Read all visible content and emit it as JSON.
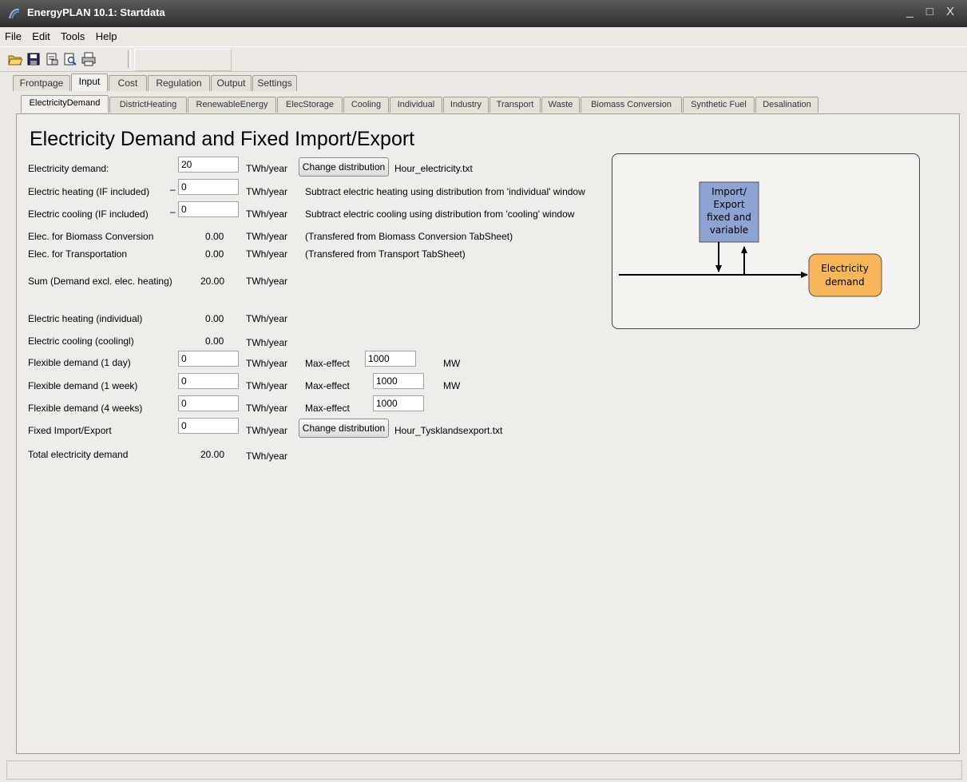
{
  "window": {
    "title": "EnergyPLAN 10.1: Startdata",
    "controls": "_ □ X"
  },
  "menu": [
    "File",
    "Edit",
    "Tools",
    "Help"
  ],
  "toolbar": [
    "open-icon",
    "save-icon",
    "properties-icon",
    "print-preview-icon",
    "print-icon"
  ],
  "main_tabs": [
    {
      "label": "Frontpage",
      "active": false
    },
    {
      "label": "Input",
      "active": true
    },
    {
      "label": "Cost",
      "active": false
    },
    {
      "label": "Regulation",
      "active": false
    },
    {
      "label": "Output",
      "active": false
    },
    {
      "label": "Settings",
      "active": false
    }
  ],
  "sub_tabs": [
    {
      "label": "ElectricityDemand",
      "active": true
    },
    {
      "label": "DistrictHeating",
      "active": false
    },
    {
      "label": "RenewableEnergy",
      "active": false
    },
    {
      "label": "ElecStorage",
      "active": false
    },
    {
      "label": "Cooling",
      "active": false
    },
    {
      "label": "Individual",
      "active": false
    },
    {
      "label": "Industry",
      "active": false
    },
    {
      "label": "Transport",
      "active": false
    },
    {
      "label": "Waste",
      "active": false
    },
    {
      "label": "Biomass Conversion",
      "active": false
    },
    {
      "label": "Synthetic Fuel",
      "active": false
    },
    {
      "label": "Desalination",
      "active": false
    }
  ],
  "page": {
    "heading": "Electricity Demand and Fixed Import/Export",
    "unit": "TWh/year",
    "minus": "–",
    "change_distribution": "Change distribution",
    "max_effect": "Max-effect",
    "mw": "MW",
    "rows": {
      "electricity_demand": {
        "label": "Electricity demand:",
        "value": "20",
        "file": "Hour_electricity.txt"
      },
      "electric_heating": {
        "label": "Electric heating (IF included)",
        "value": "0",
        "note": "Subtract electric heating using distribution from 'individual' window"
      },
      "electric_cooling": {
        "label": "Electric cooling (IF included)",
        "value": "0",
        "note": "Subtract electric cooling using distribution from 'cooling' window"
      },
      "biomass_conversion": {
        "label": "Elec. for Biomass Conversion",
        "value": "0.00",
        "note": "(Transfered from Biomass Conversion TabSheet)"
      },
      "transportation": {
        "label": "Elec. for Transportation",
        "value": "0.00",
        "note": "(Transfered from Transport TabSheet)"
      },
      "sum": {
        "label": "Sum (Demand excl. elec. heating)",
        "value": "20.00"
      },
      "heating_individual": {
        "label": "Electric heating (individual)",
        "value": "0.00"
      },
      "cooling_coolingl": {
        "label": "Electric cooling (coolingl)",
        "value": "0.00"
      },
      "flex_1day": {
        "label": "Flexible demand (1 day)",
        "value": "0",
        "max": "1000"
      },
      "flex_1week": {
        "label": "Flexible demand (1 week)",
        "value": "0",
        "max": "1000"
      },
      "flex_4weeks": {
        "label": "Flexible demand (4 weeks)",
        "value": "0",
        "max": "1000"
      },
      "fixed_import_export": {
        "label": "Fixed Import/Export",
        "value": "0",
        "file": "Hour_Tysklandsexport.txt"
      },
      "total": {
        "label": "Total electricity demand",
        "value": "20.00"
      }
    }
  },
  "diagram": {
    "import_export": [
      "Import/",
      "Export",
      "fixed and",
      "variable"
    ],
    "electricity_demand": [
      "Electricity",
      "demand"
    ],
    "colors": {
      "import_box": "#8fa3d3",
      "demand_box": "#f7b65a"
    }
  }
}
